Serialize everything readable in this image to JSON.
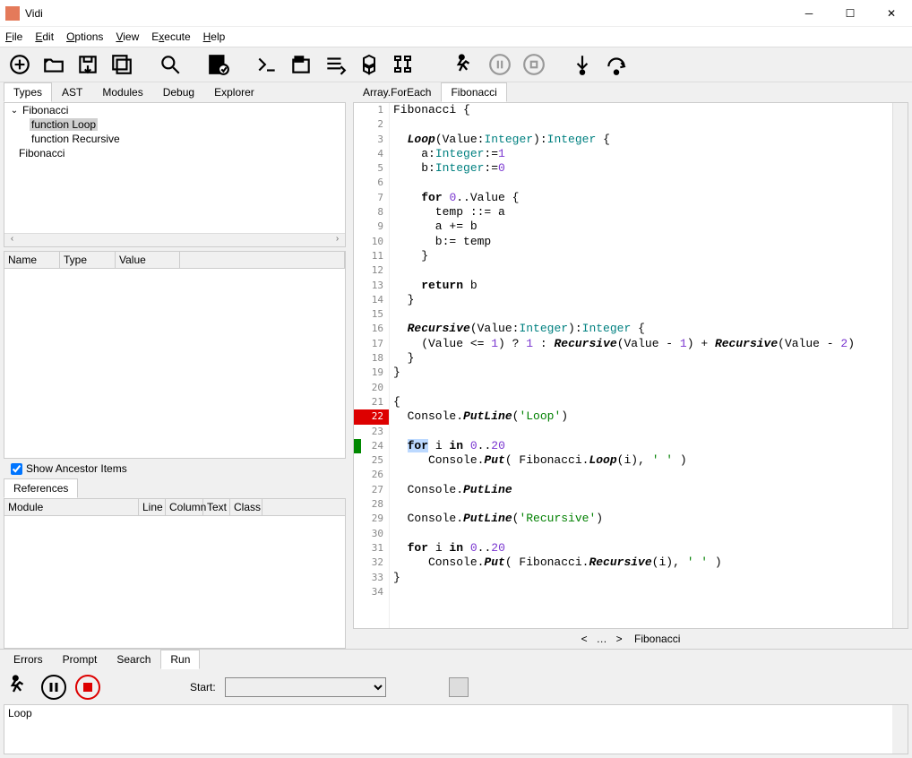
{
  "window": {
    "title": "Vidi"
  },
  "menu": [
    "File",
    "Edit",
    "Options",
    "View",
    "Execute",
    "Help"
  ],
  "left_tabs": [
    "Types",
    "AST",
    "Modules",
    "Debug",
    "Explorer"
  ],
  "tree": {
    "root": "Fibonacci",
    "items": [
      "function Loop",
      "function Recursive"
    ],
    "sibling": "Fibonacci"
  },
  "props_headers": [
    "Name",
    "Type",
    "Value"
  ],
  "show_ancestor": "Show Ancestor Items",
  "refs_tab": "References",
  "refs_headers": [
    "Module",
    "Line",
    "Column",
    "Text",
    "Class"
  ],
  "editor_tabs": [
    "Array.ForEach",
    "Fibonacci"
  ],
  "breadcrumb": {
    "left": "<",
    "dots": "…",
    "right": ">",
    "item": "Fibonacci"
  },
  "bottom_tabs": [
    "Errors",
    "Prompt",
    "Search",
    "Run"
  ],
  "run": {
    "start_label": "Start:",
    "output": "Loop"
  },
  "code_lines": [
    {
      "n": 1,
      "html": "Fibonacci {"
    },
    {
      "n": 2,
      "html": ""
    },
    {
      "n": 3,
      "html": "  <span class='fn'>Loop</span>(Value:<span class='ty'>Integer</span>):<span class='ty'>Integer</span> {"
    },
    {
      "n": 4,
      "html": "    a:<span class='ty'>Integer</span>:=<span class='nm'>1</span>"
    },
    {
      "n": 5,
      "html": "    b:<span class='ty'>Integer</span>:=<span class='nm'>0</span>"
    },
    {
      "n": 6,
      "html": ""
    },
    {
      "n": 7,
      "html": "    <span class='kw'>for</span> <span class='nm'>0</span>..Value {"
    },
    {
      "n": 8,
      "html": "      temp ::= a"
    },
    {
      "n": 9,
      "html": "      a += b"
    },
    {
      "n": 10,
      "html": "      b:= temp"
    },
    {
      "n": 11,
      "html": "    }"
    },
    {
      "n": 12,
      "html": ""
    },
    {
      "n": 13,
      "html": "    <span class='kw'>return</span> b"
    },
    {
      "n": 14,
      "html": "  }"
    },
    {
      "n": 15,
      "html": ""
    },
    {
      "n": 16,
      "html": "  <span class='fn'>Recursive</span>(Value:<span class='ty'>Integer</span>):<span class='ty'>Integer</span> {"
    },
    {
      "n": 17,
      "html": "    (Value &lt;= <span class='nm'>1</span>) ? <span class='nm'>1</span> : <span class='fn'>Recursive</span>(Value - <span class='nm'>1</span>) + <span class='fn'>Recursive</span>(Value - <span class='nm'>2</span>)"
    },
    {
      "n": 18,
      "html": "  }"
    },
    {
      "n": 19,
      "html": "}"
    },
    {
      "n": 20,
      "html": ""
    },
    {
      "n": 21,
      "html": "{"
    },
    {
      "n": 22,
      "red": true,
      "html": "  Console.<span class='fn'>PutLine</span>(<span class='st'>'Loop'</span>)"
    },
    {
      "n": 23,
      "html": ""
    },
    {
      "n": 24,
      "green": true,
      "html": "  <span class='kw hl'>for</span> i <span class='kw'>in</span> <span class='nm'>0</span>..<span class='nm'>20</span>"
    },
    {
      "n": 25,
      "html": "     Console.<span class='fn'>Put</span>( Fibonacci.<span class='fn'>Loop</span>(i), <span class='st'>' '</span> )"
    },
    {
      "n": 26,
      "html": ""
    },
    {
      "n": 27,
      "html": "  Console.<span class='fn'>PutLine</span>"
    },
    {
      "n": 28,
      "html": ""
    },
    {
      "n": 29,
      "html": "  Console.<span class='fn'>PutLine</span>(<span class='st'>'Recursive'</span>)"
    },
    {
      "n": 30,
      "html": ""
    },
    {
      "n": 31,
      "html": "  <span class='kw'>for</span> i <span class='kw'>in</span> <span class='nm'>0</span>..<span class='nm'>20</span>"
    },
    {
      "n": 32,
      "html": "     Console.<span class='fn'>Put</span>( Fibonacci.<span class='fn'>Recursive</span>(i), <span class='st'>' '</span> )"
    },
    {
      "n": 33,
      "html": "}"
    },
    {
      "n": 34,
      "html": ""
    }
  ]
}
